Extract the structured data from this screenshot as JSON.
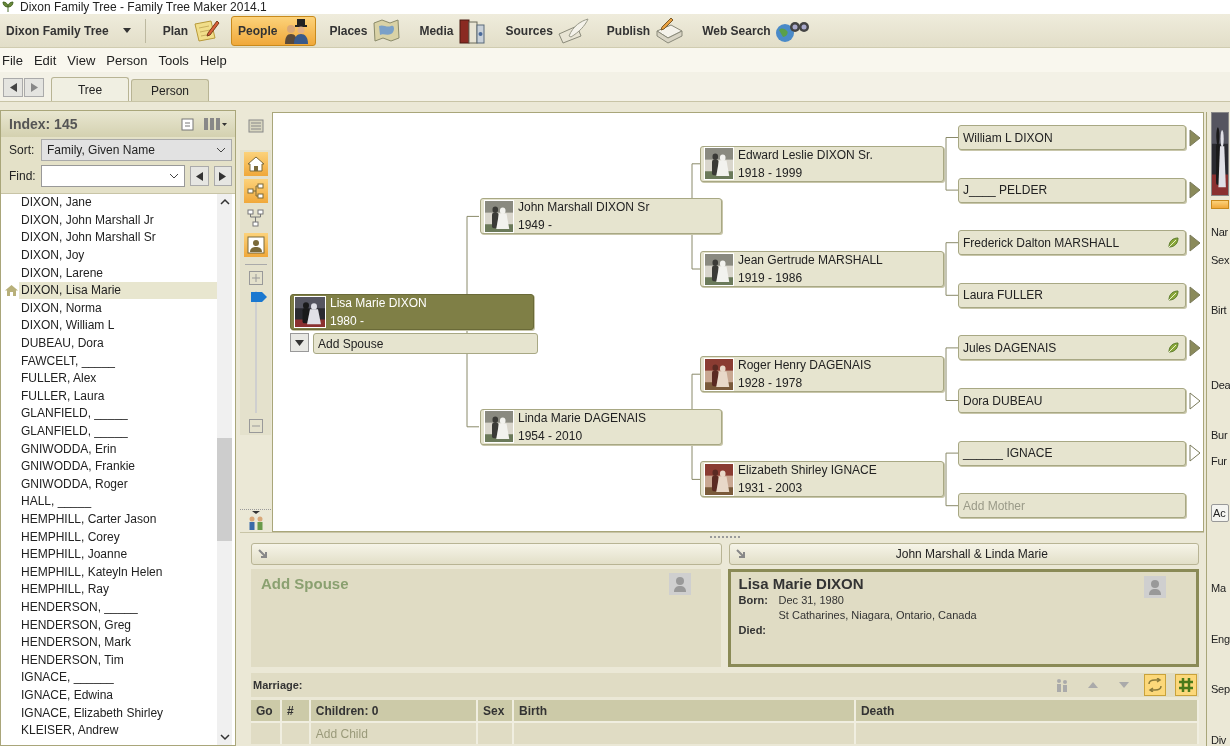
{
  "window": {
    "title": "Dixon Family Tree - Family Tree Maker 2014.1"
  },
  "toolbar": {
    "tree_name": "Dixon Family Tree",
    "workspaces": [
      {
        "label": "Plan",
        "selected": false
      },
      {
        "label": "People",
        "selected": true
      },
      {
        "label": "Places",
        "selected": false
      },
      {
        "label": "Media",
        "selected": false
      },
      {
        "label": "Sources",
        "selected": false
      },
      {
        "label": "Publish",
        "selected": false
      },
      {
        "label": "Web Search",
        "selected": false
      }
    ]
  },
  "menu": [
    "File",
    "Edit",
    "View",
    "Person",
    "Tools",
    "Help"
  ],
  "tabs": [
    {
      "label": "Tree",
      "selected": true
    },
    {
      "label": "Person",
      "selected": false
    }
  ],
  "index": {
    "title": "Index: 145",
    "sort_label": "Sort:",
    "sort_value": "Family, Given Name",
    "find_label": "Find:",
    "people": [
      {
        "name": "DIXON, Jane",
        "selected": false,
        "home_person": false
      },
      {
        "name": "DIXON, John Marshall Jr",
        "selected": false,
        "home_person": false
      },
      {
        "name": "DIXON, John Marshall Sr",
        "selected": false,
        "home_person": false
      },
      {
        "name": "DIXON, Joy",
        "selected": false,
        "home_person": false
      },
      {
        "name": "DIXON, Larene",
        "selected": false,
        "home_person": false
      },
      {
        "name": "DIXON, Lisa Marie",
        "selected": true,
        "home_person": true
      },
      {
        "name": "DIXON, Norma",
        "selected": false,
        "home_person": false
      },
      {
        "name": "DIXON, William L",
        "selected": false,
        "home_person": false
      },
      {
        "name": "DUBEAU, Dora",
        "selected": false,
        "home_person": false
      },
      {
        "name": "FAWCELT, _____",
        "selected": false,
        "home_person": false
      },
      {
        "name": "FULLER, Alex",
        "selected": false,
        "home_person": false
      },
      {
        "name": "FULLER, Laura",
        "selected": false,
        "home_person": false
      },
      {
        "name": "GLANFIELD, _____",
        "selected": false,
        "home_person": false
      },
      {
        "name": "GLANFIELD, _____",
        "selected": false,
        "home_person": false
      },
      {
        "name": "GNIWODDA, Erin",
        "selected": false,
        "home_person": false
      },
      {
        "name": "GNIWODDA, Frankie",
        "selected": false,
        "home_person": false
      },
      {
        "name": "GNIWODDA, Roger",
        "selected": false,
        "home_person": false
      },
      {
        "name": "HALL, _____",
        "selected": false,
        "home_person": false
      },
      {
        "name": "HEMPHILL, Carter Jason",
        "selected": false,
        "home_person": false
      },
      {
        "name": "HEMPHILL, Corey",
        "selected": false,
        "home_person": false
      },
      {
        "name": "HEMPHILL, Joanne",
        "selected": false,
        "home_person": false
      },
      {
        "name": "HEMPHILL, Kateyln Helen",
        "selected": false,
        "home_person": false
      },
      {
        "name": "HEMPHILL, Ray",
        "selected": false,
        "home_person": false
      },
      {
        "name": "HENDERSON, _____",
        "selected": false,
        "home_person": false
      },
      {
        "name": "HENDERSON, Greg",
        "selected": false,
        "home_person": false
      },
      {
        "name": "HENDERSON, Mark",
        "selected": false,
        "home_person": false
      },
      {
        "name": "HENDERSON, Tim",
        "selected": false,
        "home_person": false
      },
      {
        "name": "IGNACE, ______",
        "selected": false,
        "home_person": false
      },
      {
        "name": "IGNACE, Edwina",
        "selected": false,
        "home_person": false
      },
      {
        "name": "IGNACE, Elizabeth Shirley",
        "selected": false,
        "home_person": false
      },
      {
        "name": "KLEISER, Andrew",
        "selected": false,
        "home_person": false
      }
    ]
  },
  "tree": {
    "tools": [
      {
        "kind": "home",
        "selected": true
      },
      {
        "kind": "pedigree",
        "selected": true
      },
      {
        "kind": "family",
        "selected": false
      },
      {
        "kind": "person",
        "selected": true
      }
    ],
    "zoom": {
      "level": 0.95
    },
    "root": {
      "name": "Lisa Marie DIXON",
      "dates": "1980 -",
      "selected": true
    },
    "add_spouse": "Add Spouse",
    "parents": [
      {
        "name": "John Marshall DIXON Sr",
        "dates": "1949 -",
        "selected": false
      },
      {
        "name": "Linda Marie DAGENAIS",
        "dates": "1954 - 2010",
        "selected": false
      }
    ],
    "grandparents": [
      {
        "name": "Edward Leslie DIXON Sr.",
        "dates": "1918 - 1999",
        "selected": false
      },
      {
        "name": "Jean Gertrude MARSHALL",
        "dates": "1919 - 1986",
        "selected": false
      },
      {
        "name": "Roger Henry DAGENAIS",
        "dates": "1928 - 1978",
        "selected": false
      },
      {
        "name": "Elizabeth Shirley IGNACE",
        "dates": "1931 - 2003",
        "selected": false
      }
    ],
    "great_grandparents": [
      {
        "kind": "person",
        "name": "William L DIXON",
        "selected": false,
        "leaf": false,
        "has_parents": true
      },
      {
        "kind": "person",
        "name": "J____ PELDER",
        "selected": false,
        "leaf": false,
        "has_parents": true
      },
      {
        "kind": "person",
        "name": "Frederick Dalton MARSHALL",
        "selected": false,
        "leaf": true,
        "has_parents": true
      },
      {
        "kind": "person",
        "name": "Laura FULLER",
        "selected": false,
        "leaf": true,
        "has_parents": true
      },
      {
        "kind": "person",
        "name": "Jules DAGENAIS",
        "selected": false,
        "leaf": true,
        "has_parents": true
      },
      {
        "kind": "person",
        "name": "Dora DUBEAU",
        "selected": false,
        "leaf": false,
        "has_parents": false
      },
      {
        "kind": "person",
        "name": "______ IGNACE",
        "selected": false,
        "leaf": false,
        "has_parents": false
      },
      {
        "kind": "placeholder",
        "name": "Add Mother",
        "selected": false,
        "leaf": false
      }
    ]
  },
  "family": {
    "couple": "John Marshall & Linda Marie",
    "spouse_placeholder": "Add Spouse",
    "person": {
      "name": "Lisa Marie DIXON",
      "born_label": "Born:",
      "born_date": "Dec 31, 1980",
      "born_place": "St Catharines, Niagara, Ontario, Canada",
      "died_label": "Died:"
    },
    "marriage_label": "Marriage:",
    "tools": [
      {
        "kind": "children",
        "selected": false
      },
      {
        "kind": "up",
        "selected": false
      },
      {
        "kind": "down",
        "selected": false
      },
      {
        "kind": "swap",
        "selected": true
      },
      {
        "kind": "grid",
        "selected": true
      }
    ],
    "children_table": {
      "columns": [
        "Go",
        "#",
        "Children: 0",
        "Sex",
        "Birth",
        "Death"
      ],
      "placeholder": "Add Child"
    }
  },
  "edge_panel": {
    "labels": [
      "Nar",
      "Sex",
      "Birt",
      "Dea",
      "Bur",
      "Fur",
      "Ma",
      "Eng",
      "Sep",
      "Div"
    ],
    "button": "Ac"
  }
}
